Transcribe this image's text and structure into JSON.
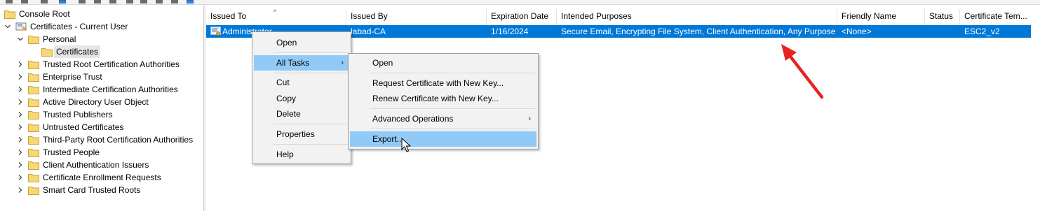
{
  "tree": {
    "root": "Console Root",
    "store": "Certificates - Current User",
    "personal": "Personal",
    "certificates": "Certificates",
    "folders": [
      "Trusted Root Certification Authorities",
      "Enterprise Trust",
      "Intermediate Certification Authorities",
      "Active Directory User Object",
      "Trusted Publishers",
      "Untrusted Certificates",
      "Third-Party Root Certification Authorities",
      "Trusted People",
      "Client Authentication Issuers",
      "Certificate Enrollment Requests",
      "Smart Card Trusted Roots"
    ]
  },
  "list": {
    "columns": [
      "Issued To",
      "Issued By",
      "Expiration Date",
      "Intended Purposes",
      "Friendly Name",
      "Status",
      "Certificate Tem..."
    ],
    "rows": [
      {
        "issued_to": "Administrator",
        "issued_by": "labad-CA",
        "expiration": "1/16/2024",
        "purposes": "Secure Email, Encrypting File System, Client Authentication, Any Purpose",
        "friendly_name": "<None>",
        "status": "",
        "template": "ESC2_v2"
      }
    ]
  },
  "context_menu": {
    "open": "Open",
    "all_tasks": "All Tasks",
    "cut": "Cut",
    "copy": "Copy",
    "delete": "Delete",
    "properties": "Properties",
    "help": "Help"
  },
  "submenu": {
    "open": "Open",
    "request_new_key": "Request Certificate with New Key...",
    "renew_new_key": "Renew Certificate with New Key...",
    "advanced": "Advanced Operations",
    "export": "Export..."
  },
  "colors": {
    "selection": "#0078d7",
    "menu_highlight": "#91c9f7",
    "folder": "#f8d775",
    "annotation_arrow": "#e8231f"
  }
}
